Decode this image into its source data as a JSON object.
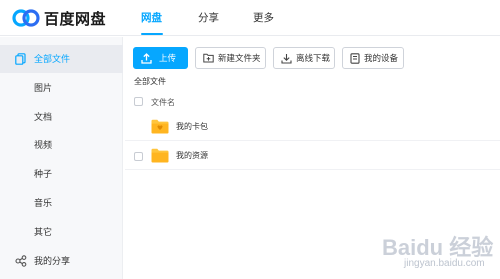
{
  "app": {
    "logo_text": "百度网盘"
  },
  "nav": {
    "tabs": [
      {
        "label": "网盘",
        "active": true
      },
      {
        "label": "分享"
      },
      {
        "label": "更多"
      }
    ]
  },
  "sidebar": {
    "items": [
      {
        "label": "全部文件",
        "icon": "files-icon",
        "active": true
      },
      {
        "label": "图片"
      },
      {
        "label": "文档"
      },
      {
        "label": "视频"
      },
      {
        "label": "种子"
      },
      {
        "label": "音乐"
      },
      {
        "label": "其它"
      },
      {
        "label": "我的分享",
        "icon": "share-icon"
      }
    ]
  },
  "toolbar": {
    "upload": "上传",
    "new_folder": "新建文件夹",
    "offline_download": "离线下载",
    "my_devices": "我的设备"
  },
  "breadcrumb": "全部文件",
  "file_list": {
    "column_name": "文件名",
    "rows": [
      {
        "name": "我的卡包",
        "type": "card-folder-icon"
      },
      {
        "name": "我的资源",
        "type": "folder-icon"
      }
    ]
  },
  "watermark": {
    "main": "Baidu 经验",
    "sub": "jingyan.baidu.com"
  },
  "colors": {
    "accent": "#06a7ff",
    "folder": "#ffc53d",
    "sidebar_bg": "#f7f8fa"
  }
}
